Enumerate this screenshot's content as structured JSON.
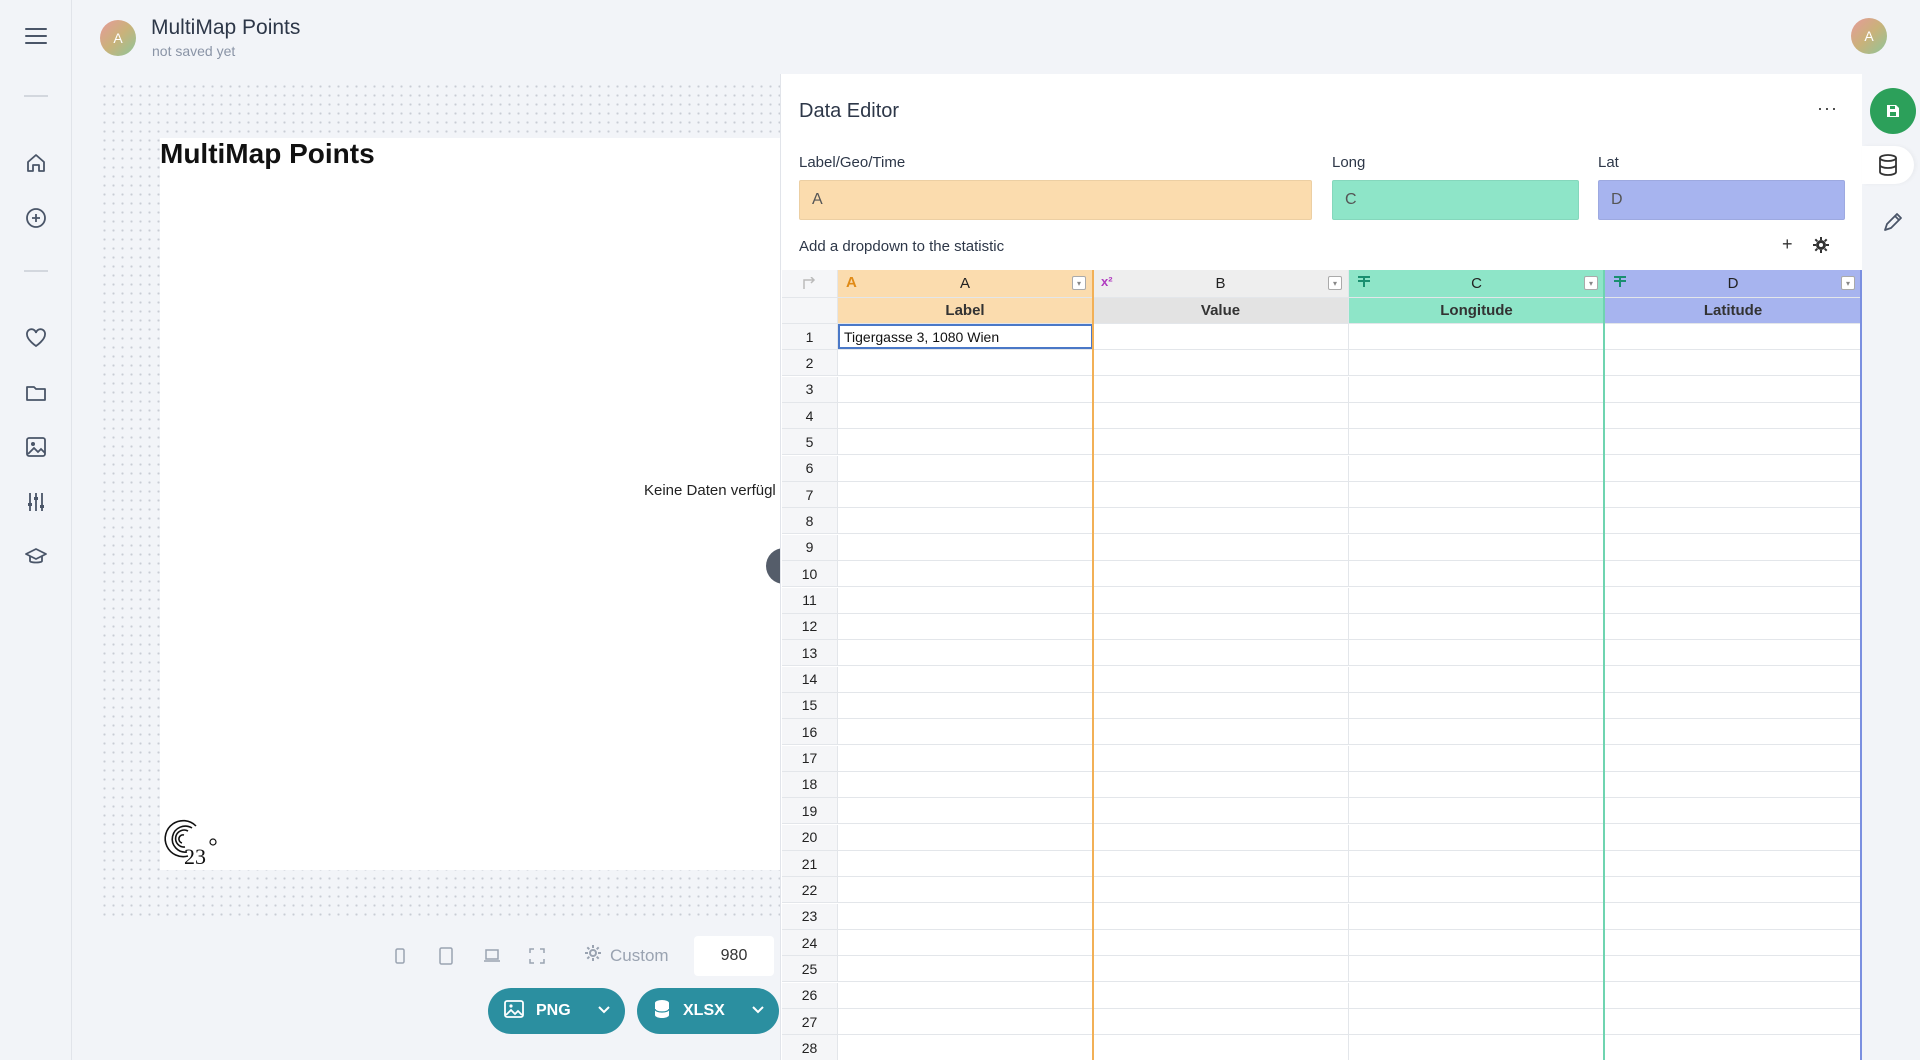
{
  "header": {
    "avatar_letter": "A",
    "title": "MultiMap Points",
    "subtitle": "not saved yet",
    "user_avatar_letter": "A"
  },
  "sidebar": {
    "icons": [
      "menu-icon",
      "home-icon",
      "add-circle-icon",
      "heart-icon",
      "folder-icon",
      "image-icon",
      "sliders-icon",
      "graduation-cap-icon"
    ]
  },
  "chart": {
    "title": "MultiMap Points",
    "empty_message": "Keine Daten verfügl"
  },
  "toolbar": {
    "custom_label": "Custom",
    "width_value": "980",
    "png_label": "PNG",
    "xlsx_label": "XLSX"
  },
  "data_editor": {
    "title": "Data Editor",
    "more_label": "···",
    "fields": [
      {
        "label": "Label/Geo/Time",
        "value": "A",
        "color": "#fbdcae"
      },
      {
        "label": "Long",
        "value": "C",
        "color": "#8ee5c8"
      },
      {
        "label": "Lat",
        "value": "D",
        "color": "#a7b4ef"
      }
    ],
    "dropdown_text": "Add a dropdown to the statistic",
    "add_label": "+",
    "columns": [
      {
        "letter": "A",
        "name": "Label",
        "type_icon": "A",
        "color": "#fbdcae"
      },
      {
        "letter": "B",
        "name": "Value",
        "type_icon": "x²",
        "color": "#e8e8e8"
      },
      {
        "letter": "C",
        "name": "Longitude",
        "type_icon": "⚲",
        "color": "#8ee5c8"
      },
      {
        "letter": "D",
        "name": "Latitude",
        "type_icon": "⚲",
        "color": "#a7b4ef"
      }
    ],
    "rows": [
      [
        "1",
        "Tigergasse 3, 1080 Wien"
      ],
      [
        "2",
        ""
      ],
      [
        "3",
        ""
      ],
      [
        "4",
        ""
      ],
      [
        "5",
        ""
      ],
      [
        "6",
        ""
      ],
      [
        "7",
        ""
      ],
      [
        "8",
        ""
      ],
      [
        "9",
        ""
      ],
      [
        "10",
        ""
      ],
      [
        "11",
        ""
      ],
      [
        "12",
        ""
      ],
      [
        "13",
        ""
      ],
      [
        "14",
        ""
      ],
      [
        "15",
        ""
      ],
      [
        "16",
        ""
      ],
      [
        "17",
        ""
      ],
      [
        "18",
        ""
      ],
      [
        "19",
        ""
      ],
      [
        "20",
        ""
      ],
      [
        "21",
        ""
      ],
      [
        "22",
        ""
      ],
      [
        "23",
        ""
      ],
      [
        "24",
        ""
      ],
      [
        "25",
        ""
      ],
      [
        "26",
        ""
      ],
      [
        "27",
        ""
      ],
      [
        "28",
        ""
      ]
    ]
  },
  "colors": {
    "accent_teal": "#2b8fa0",
    "save_green": "#2ca05a",
    "col_a": "#fbdcae",
    "col_c": "#8ee5c8",
    "col_d": "#a7b4ef"
  }
}
